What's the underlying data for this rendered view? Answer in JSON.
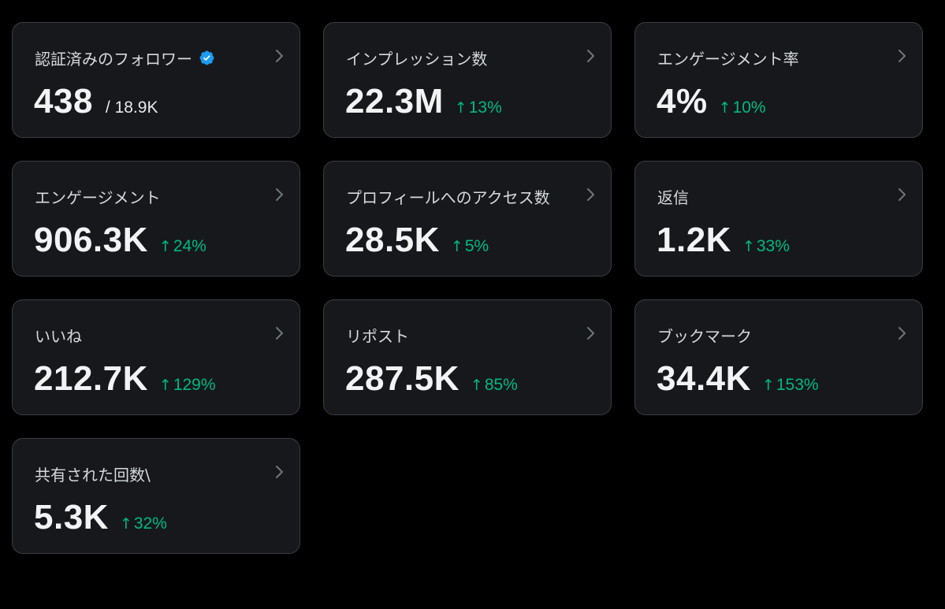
{
  "colors": {
    "background": "#000000",
    "card": "#16181c",
    "border": "#3a3d42",
    "positive": "#00ba7c",
    "verified": "#1d9bf0"
  },
  "cards": [
    {
      "title": "認証済みのフォロワー",
      "value": "438",
      "sub": "/ 18.9K",
      "badge": "verified-badge-icon"
    },
    {
      "title": "インプレッション数",
      "value": "22.3M",
      "change": "13%",
      "arrow": "↑"
    },
    {
      "title": "エンゲージメント率",
      "value": "4%",
      "change": "10%",
      "arrow": "↑"
    },
    {
      "title": "エンゲージメント",
      "value": "906.3K",
      "change": "24%",
      "arrow": "↑"
    },
    {
      "title": "プロフィールへのアクセス数",
      "value": "28.5K",
      "change": "5%",
      "arrow": "↑"
    },
    {
      "title": "返信",
      "value": "1.2K",
      "change": "33%",
      "arrow": "↑"
    },
    {
      "title": "いいね",
      "value": "212.7K",
      "change": "129%",
      "arrow": "↑"
    },
    {
      "title": "リポスト",
      "value": "287.5K",
      "change": "85%",
      "arrow": "↑"
    },
    {
      "title": "ブックマーク",
      "value": "34.4K",
      "change": "153%",
      "arrow": "↑"
    },
    {
      "title": "共有された回数\\",
      "value": "5.3K",
      "change": "32%",
      "arrow": "↑"
    }
  ]
}
